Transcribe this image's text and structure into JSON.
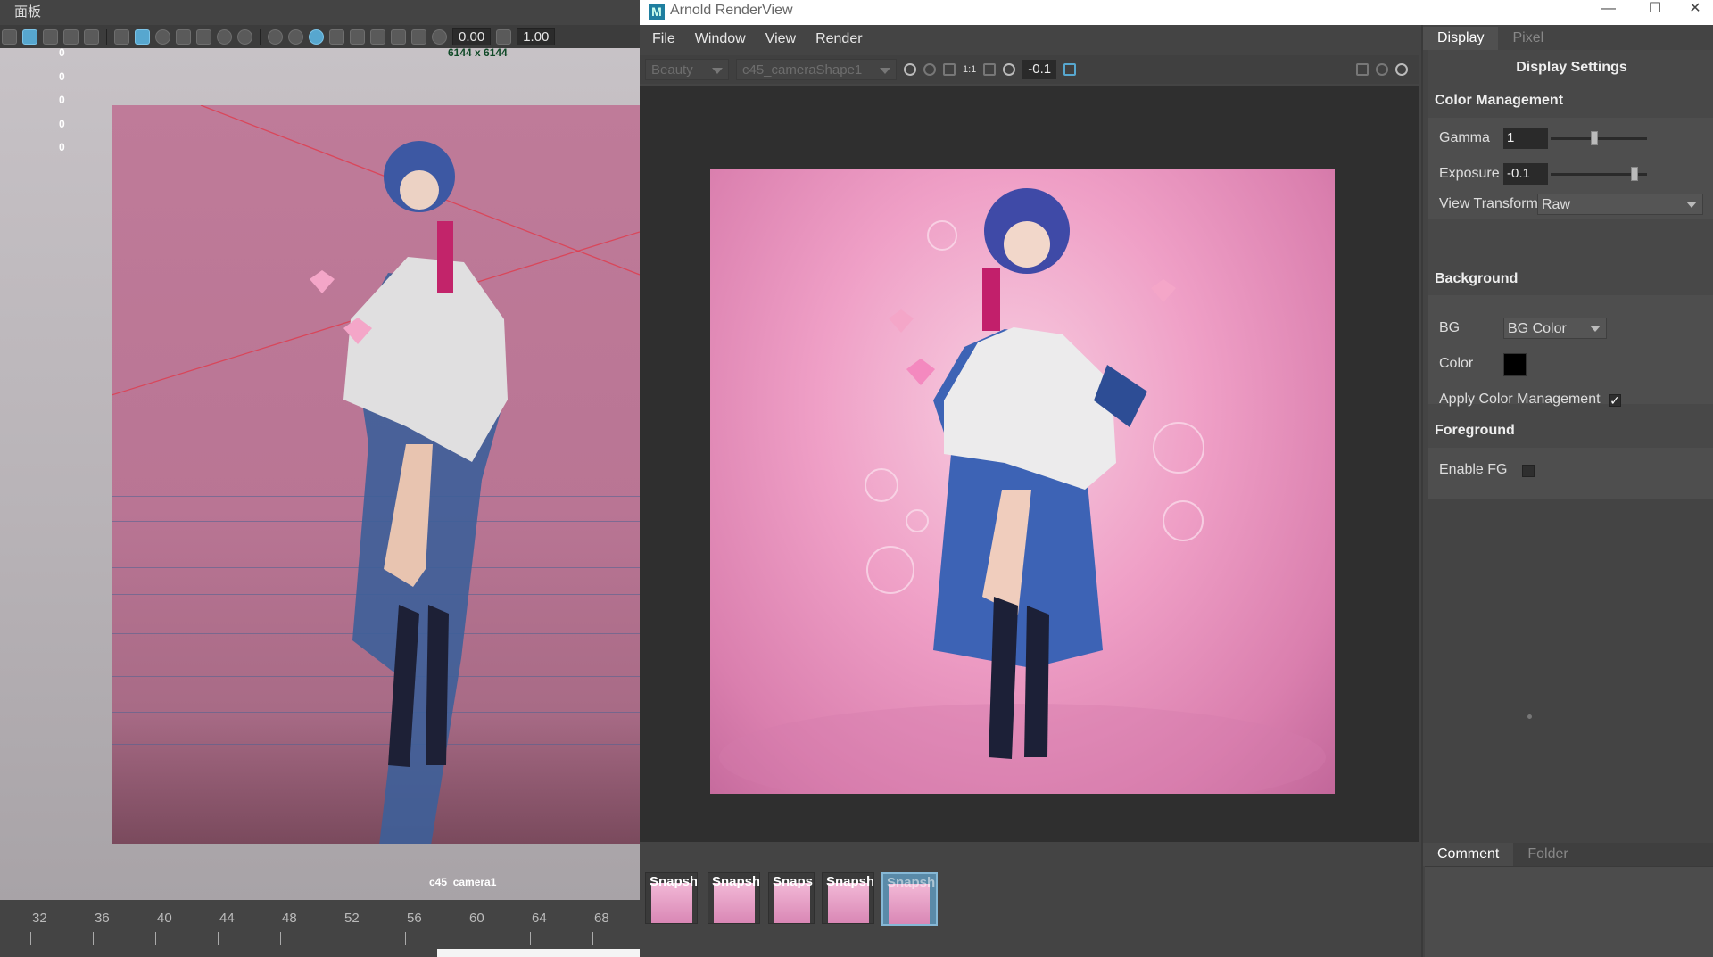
{
  "maya": {
    "panel_title": "面板",
    "toolbar_fields": [
      "0.00",
      "1.00"
    ],
    "resolution": "6144 x 6144",
    "hud_values": [
      "0",
      "0",
      "0",
      "0",
      "0"
    ],
    "camera_name": "c45_camera1",
    "timeline_ticks": [
      "32",
      "36",
      "40",
      "44",
      "48",
      "52",
      "56",
      "60",
      "64",
      "68"
    ]
  },
  "arnold": {
    "window_title": "Arnold RenderView",
    "logo_letter": "M",
    "window_buttons": {
      "minimize": "—",
      "maximize": "☐",
      "close": "✕"
    },
    "menu": [
      "File",
      "Window",
      "View",
      "Render"
    ],
    "toolbar": {
      "aov": "Beauty",
      "camera": "c45_cameraShape1",
      "ratio_label": "1:1",
      "exposure": "-0.1"
    },
    "snapshots": [
      "Snapsh",
      "Snapsh",
      "Snaps",
      "Snapsh",
      "Snapsh"
    ],
    "right_panel": {
      "tabs": [
        "Display",
        "Pixel"
      ],
      "title": "Display Settings",
      "color_management": {
        "heading": "Color Management",
        "gamma_label": "Gamma",
        "gamma_value": "1",
        "exposure_label": "Exposure",
        "exposure_value": "-0.1",
        "view_transform_label": "View Transform",
        "view_transform_value": "Raw"
      },
      "background": {
        "heading": "Background",
        "bg_label": "BG",
        "bg_value": "BG Color",
        "color_label": "Color",
        "color_value": "#000000",
        "apply_cm_label": "Apply Color Management",
        "apply_cm_checked": true
      },
      "foreground": {
        "heading": "Foreground",
        "enable_fg_label": "Enable FG",
        "enable_fg_checked": false
      },
      "bottom_tabs": [
        "Comment",
        "Folder"
      ]
    }
  },
  "colors": {
    "accent": "#57a7cf",
    "viewport_pink": "#bf7b99",
    "render_pink": "#ef9fc6"
  }
}
